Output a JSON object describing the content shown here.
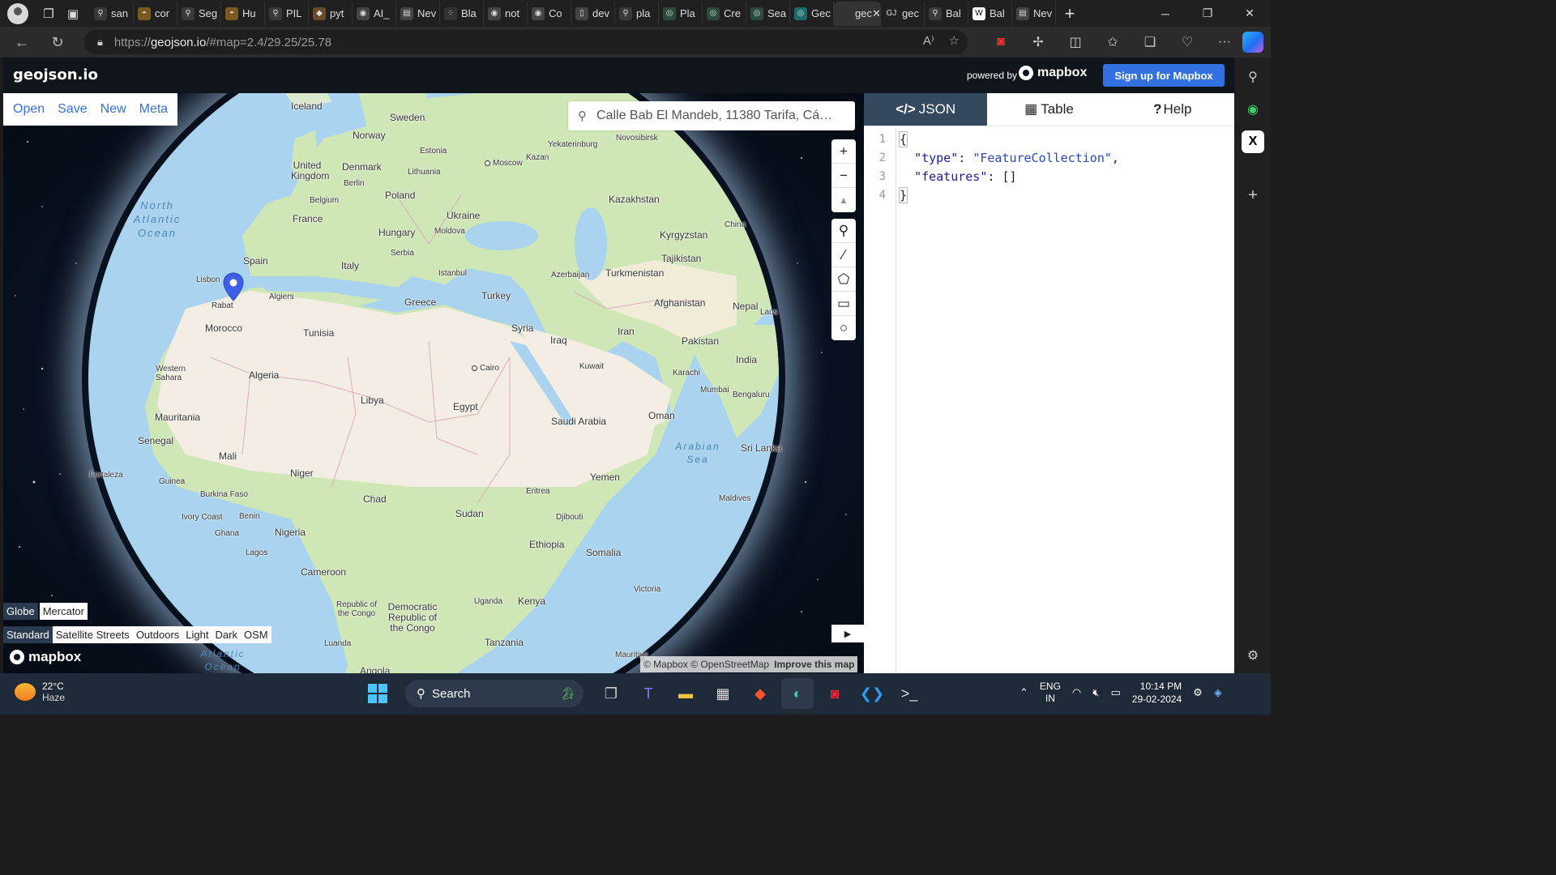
{
  "browser": {
    "tabs": [
      {
        "label": "san",
        "icon": "search-icon",
        "color": "#3a3a3a"
      },
      {
        "label": "cor",
        "icon": "hat-icon",
        "color": "#7a5a20"
      },
      {
        "label": "Seg",
        "icon": "search-icon",
        "color": "#3a3a3a"
      },
      {
        "label": "Hu",
        "icon": "hat-icon",
        "color": "#7a5a20"
      },
      {
        "label": "PIL",
        "icon": "search-icon",
        "color": "#3a3a3a"
      },
      {
        "label": "pyt",
        "icon": "python-icon",
        "color": "#6b4a2a"
      },
      {
        "label": "AI_",
        "icon": "github-icon",
        "color": "#444"
      },
      {
        "label": "Nev",
        "icon": "page-icon",
        "color": "#444"
      },
      {
        "label": "Bla",
        "icon": "dots-icon",
        "color": "#333"
      },
      {
        "label": "not",
        "icon": "github-icon",
        "color": "#444"
      },
      {
        "label": "Co",
        "icon": "github-icon",
        "color": "#444"
      },
      {
        "label": "dev",
        "icon": "document-icon",
        "color": "#444"
      },
      {
        "label": "pla",
        "icon": "search-icon",
        "color": "#3a3a3a"
      },
      {
        "label": "Pla",
        "icon": "circle-icon",
        "color": "#2a4a3a"
      },
      {
        "label": "Cre",
        "icon": "circle-icon",
        "color": "#2a4a3a"
      },
      {
        "label": "Sea",
        "icon": "circle-icon",
        "color": "#2a4a3a"
      },
      {
        "label": "Gec",
        "icon": "circle-icon",
        "color": "#1e6a6a"
      },
      {
        "label": "gec",
        "icon": "close-icon",
        "color": "#333",
        "active": true
      },
      {
        "label": "gec",
        "icon": "gj-icon",
        "color": "#222"
      },
      {
        "label": "Bal",
        "icon": "search-icon",
        "color": "#3a3a3a"
      },
      {
        "label": "Bal",
        "icon": "wikipedia-icon",
        "color": "#fff"
      },
      {
        "label": "Nev",
        "icon": "page-icon",
        "color": "#444"
      }
    ],
    "url": "https://geojson.io/#map=2.4/29.25/25.78",
    "url_host": "geojson.io",
    "url_rest": "/#map=2.4/29.25/25.78",
    "url_prefix": "https://"
  },
  "app": {
    "title": "geojson.io",
    "powered_by": "powered by",
    "mapbox": "mapbox",
    "signup": "Sign up for Mapbox",
    "menu": [
      "Open",
      "Save",
      "New",
      "Meta"
    ],
    "search_value": "Calle Bab El Mandeb, 11380 Tarifa, Cá…",
    "projections": [
      "Globe",
      "Mercator"
    ],
    "styles": [
      "Standard",
      "Satellite Streets",
      "Outdoors",
      "Light",
      "Dark",
      "OSM"
    ],
    "attribution": {
      "mapbox": "© Mapbox",
      "osm": "© OpenStreetMap",
      "improve": "Improve this map"
    },
    "map_logo": "mapbox"
  },
  "map_labels": [
    {
      "text": "Iceland"
    },
    {
      "text": "Sweden"
    },
    {
      "text": "Norway"
    },
    {
      "text": "Estonia"
    },
    {
      "text": "Yekaterinburg"
    },
    {
      "text": "Novosibirsk"
    },
    {
      "text": "United Kingdom"
    },
    {
      "text": "Denmark"
    },
    {
      "text": "Lithuania"
    },
    {
      "text": "Moscow"
    },
    {
      "text": "Kazan"
    },
    {
      "text": "Berlin"
    },
    {
      "text": "Poland"
    },
    {
      "text": "Belgium"
    },
    {
      "text": "Kazakhstan"
    },
    {
      "text": "France"
    },
    {
      "text": "Ukraine"
    },
    {
      "text": "Hungary"
    },
    {
      "text": "Moldova"
    },
    {
      "text": "China"
    },
    {
      "text": "Kyrgyzstan"
    },
    {
      "text": "Spain"
    },
    {
      "text": "Serbia"
    },
    {
      "text": "Italy"
    },
    {
      "text": "Tajikistan"
    },
    {
      "text": "Istanbul"
    },
    {
      "text": "Azerbaijan"
    },
    {
      "text": "Turkmenistan"
    },
    {
      "text": "Lisbon"
    },
    {
      "text": "Algiers"
    },
    {
      "text": "Greece"
    },
    {
      "text": "Turkey"
    },
    {
      "text": "Afghanistan"
    },
    {
      "text": "Nepal"
    },
    {
      "text": "Laos"
    },
    {
      "text": "Rabat"
    },
    {
      "text": "Morocco"
    },
    {
      "text": "Tunisia"
    },
    {
      "text": "Syria"
    },
    {
      "text": "Iran"
    },
    {
      "text": "Iraq"
    },
    {
      "text": "Pakistan"
    },
    {
      "text": "India"
    },
    {
      "text": "Kuwait"
    },
    {
      "text": "Western Sahara"
    },
    {
      "text": "Algeria"
    },
    {
      "text": "Cairo"
    },
    {
      "text": "Karachi"
    },
    {
      "text": "Libya"
    },
    {
      "text": "Mumbai"
    },
    {
      "text": "Egypt"
    },
    {
      "text": "Mauritania"
    },
    {
      "text": "Saudi Arabia"
    },
    {
      "text": "Oman"
    },
    {
      "text": "Bengaluru"
    },
    {
      "text": "Senegal"
    },
    {
      "text": "Sri Lanka"
    },
    {
      "text": "Mali"
    },
    {
      "text": "Niger"
    },
    {
      "text": "Fortaleza"
    },
    {
      "text": "Yemen"
    },
    {
      "text": "Guinea"
    },
    {
      "text": "Burkina Faso"
    },
    {
      "text": "Chad"
    },
    {
      "text": "Eritrea"
    },
    {
      "text": "Sudan"
    },
    {
      "text": "Maldives"
    },
    {
      "text": "Ivory Coast"
    },
    {
      "text": "Benin"
    },
    {
      "text": "Djibouti"
    },
    {
      "text": "Ghana"
    },
    {
      "text": "Nigeria"
    },
    {
      "text": "Ethiopia"
    },
    {
      "text": "Lagos"
    },
    {
      "text": "Somalia"
    },
    {
      "text": "Cameroon"
    },
    {
      "text": "Victoria"
    },
    {
      "text": "Republic of the Congo"
    },
    {
      "text": "Democratic Republic of the Congo"
    },
    {
      "text": "Uganda"
    },
    {
      "text": "Kenya"
    },
    {
      "text": "Tanzania"
    },
    {
      "text": "Luanda"
    },
    {
      "text": "Mauritius"
    },
    {
      "text": "Angola"
    },
    {
      "text": "North Atlantic Ocean"
    },
    {
      "text": "Arabian Sea"
    },
    {
      "text": "Atlantic Ocean"
    }
  ],
  "panel": {
    "tabs": [
      "JSON",
      "Table",
      "Help"
    ],
    "line_numbers": [
      "1",
      "2",
      "3",
      "4"
    ],
    "code": {
      "open": "{",
      "key_type": "\"type\"",
      "val_type": "\"FeatureCollection\"",
      "key_features": "\"features\"",
      "val_features": "[]",
      "close": "}"
    }
  },
  "taskbar": {
    "temp": "22°C",
    "weather": "Haze",
    "search": "Search",
    "lang1": "ENG",
    "lang2": "IN",
    "time": "10:14 PM",
    "date": "29-02-2024"
  },
  "colors": {
    "accent": "#3370e0",
    "header_bg": "#10151b",
    "panel_tab_active": "#34495e",
    "marker": "#3f5ee8",
    "ocean": "#a9d3ef",
    "land": "#cfe6b6",
    "desert": "#f4ede4"
  }
}
